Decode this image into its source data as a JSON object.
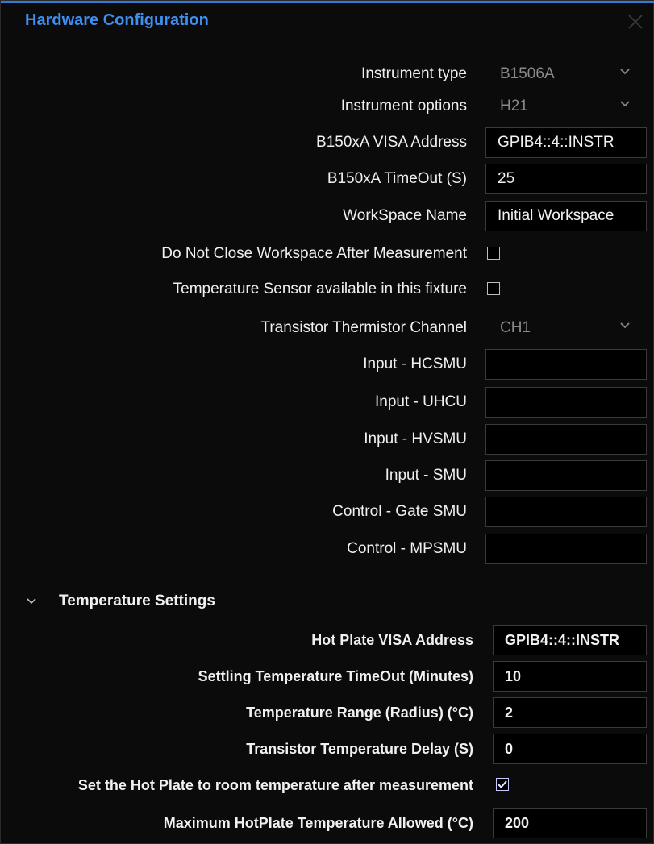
{
  "window": {
    "title": "Hardware Configuration",
    "close_icon": "close-icon"
  },
  "fields": {
    "instrument_type": {
      "label": "Instrument type",
      "value": "B1506A"
    },
    "instrument_options": {
      "label": "Instrument options",
      "value": "H21"
    },
    "visa_address": {
      "label": "B150xA VISA Address",
      "value": "GPIB4::4::INSTR"
    },
    "timeout": {
      "label": "B150xA TimeOut (S)",
      "value": "25"
    },
    "workspace_name": {
      "label": "WorkSpace Name",
      "value": "Initial Workspace"
    },
    "do_not_close": {
      "label": "Do Not Close Workspace After Measurement",
      "checked": false
    },
    "temp_sensor": {
      "label": "Temperature Sensor available in this fixture",
      "checked": false
    },
    "thermistor_channel": {
      "label": "Transistor Thermistor  Channel",
      "value": "CH1"
    },
    "input_hcsmu": {
      "label": "Input - HCSMU",
      "value": ""
    },
    "input_uhcu": {
      "label": "Input - UHCU",
      "value": ""
    },
    "input_hvsmu": {
      "label": "Input - HVSMU",
      "value": ""
    },
    "input_smu": {
      "label": "Input - SMU",
      "value": ""
    },
    "control_gate_smu": {
      "label": "Control - Gate SMU",
      "value": ""
    },
    "control_mpsmu": {
      "label": "Control - MPSMU",
      "value": ""
    }
  },
  "temperature_settings": {
    "header": "Temperature Settings",
    "expanded": true,
    "hot_plate_visa": {
      "label": "Hot Plate VISA Address",
      "value": "GPIB4::4::INSTR"
    },
    "settling_timeout": {
      "label": "Settling Temperature TimeOut (Minutes)",
      "value": "10"
    },
    "temp_range": {
      "label": "Temperature Range (Radius) (°C)",
      "value": "2"
    },
    "transistor_delay": {
      "label": "Transistor Temperature Delay (S)",
      "value": "0"
    },
    "room_temp_after": {
      "label": "Set the Hot Plate to room temperature after measurement",
      "checked": true
    },
    "max_hotplate_temp": {
      "label": "Maximum HotPlate Temperature Allowed (°C)",
      "value": "200"
    }
  },
  "colors": {
    "accent": "#3f8ef0",
    "background": "#0b0b0b",
    "field_border": "#3a3a3a"
  }
}
